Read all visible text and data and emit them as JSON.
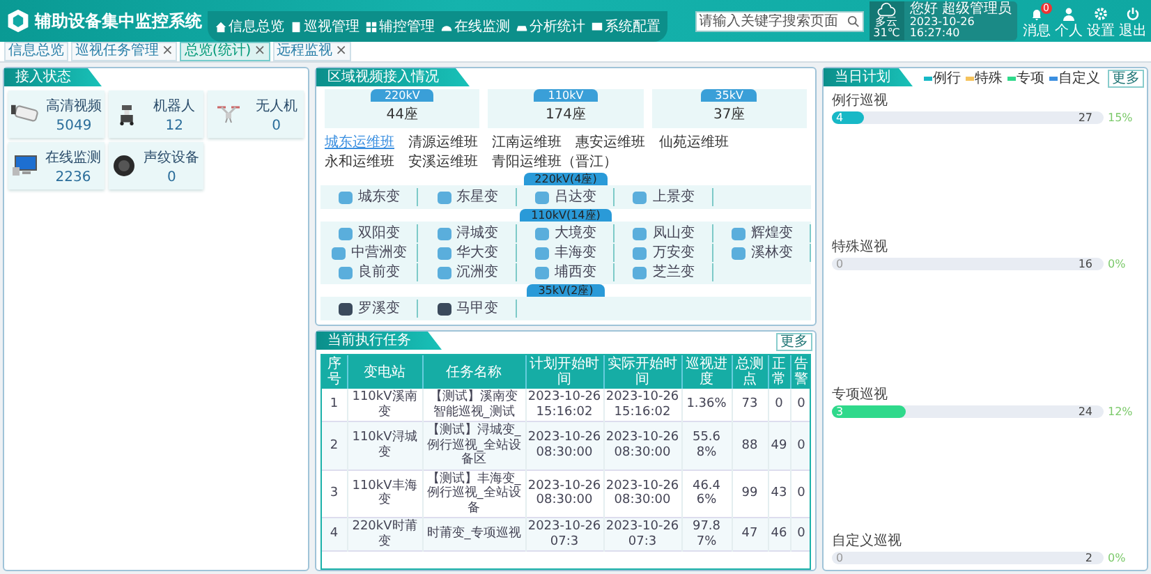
{
  "header": {
    "title": "辅助设备集中监控系统",
    "nav": [
      {
        "label": "信息总览",
        "kind": "home"
      },
      {
        "label": "巡视管理",
        "kind": "patrol"
      },
      {
        "label": "辅控管理",
        "kind": "control"
      },
      {
        "label": "在线监测",
        "kind": "monitor"
      },
      {
        "label": "分析统计",
        "kind": "chart"
      },
      {
        "label": "系统配置",
        "kind": "config"
      }
    ],
    "search": {
      "placeholder": "请输入关键字搜索页面"
    },
    "weather": {
      "condition": "多云",
      "temperature": "31℃"
    },
    "user": {
      "greeting": "您好 超级管理员",
      "date": "2023-10-26",
      "time": "16:27:40"
    },
    "actions": [
      {
        "label": "消息",
        "kind": "bell",
        "badge": "0"
      },
      {
        "label": "个人",
        "kind": "person"
      },
      {
        "label": "设置",
        "kind": "gear"
      },
      {
        "label": "退出",
        "kind": "power"
      }
    ]
  },
  "tabs": [
    {
      "label": "信息总览",
      "selected": false
    },
    {
      "label": "巡视任务管理",
      "close": "×",
      "selected": false
    },
    {
      "label": "总览(统计)",
      "close": "×",
      "selected": true
    },
    {
      "label": "远程监视",
      "close": "×",
      "selected": false
    }
  ],
  "access_status": {
    "title": "接入状态",
    "items": [
      {
        "kind": "camera",
        "label": "高清视频",
        "count": "5049"
      },
      {
        "kind": "robot",
        "label": "机器人",
        "count": "12"
      },
      {
        "kind": "drone",
        "label": "无人机",
        "count": "0"
      },
      {
        "kind": "monitor",
        "label": "在线监测",
        "count": "2236"
      },
      {
        "kind": "sound",
        "label": "声纹设备",
        "count": "0"
      }
    ]
  },
  "regional_video": {
    "title": "区域视频接入情况",
    "voltage_summary": [
      {
        "level": "220kV",
        "count": "44座"
      },
      {
        "level": "110kV",
        "count": "174座"
      },
      {
        "level": "35kV",
        "count": "37座"
      }
    ],
    "teams": [
      {
        "label": "城东运维班",
        "selected": true
      },
      {
        "label": "清源运维班",
        "selected": false
      },
      {
        "label": "江南运维班",
        "selected": false
      },
      {
        "label": "惠安运维班",
        "selected": false
      },
      {
        "label": "仙苑运维班",
        "selected": false
      },
      {
        "label": "永和运维班",
        "selected": false
      },
      {
        "label": "安溪运维班",
        "selected": false
      },
      {
        "label": "青阳运维班（晋江）",
        "selected": false
      }
    ],
    "groups": [
      {
        "label": "220kV(4座)",
        "stations": [
          {
            "name": "城东变",
            "online": true
          },
          {
            "name": "东星变",
            "online": true
          },
          {
            "name": "吕达变",
            "online": true
          },
          {
            "name": "上景变",
            "online": true
          }
        ]
      },
      {
        "label": "110kV(14座)",
        "stations": [
          {
            "name": "双阳变",
            "online": true
          },
          {
            "name": "浔城变",
            "online": true
          },
          {
            "name": "大境变",
            "online": true
          },
          {
            "name": "凤山变",
            "online": true
          },
          {
            "name": "辉煌变",
            "online": true
          },
          {
            "name": "中营洲变",
            "online": true
          },
          {
            "name": "华大变",
            "online": true
          },
          {
            "name": "丰海变",
            "online": true
          },
          {
            "name": "万安变",
            "online": true
          },
          {
            "name": "溪林变",
            "online": true
          },
          {
            "name": "良前变",
            "online": true
          },
          {
            "name": "沉洲变",
            "online": true
          },
          {
            "name": "埔西变",
            "online": true
          },
          {
            "name": "芝兰变",
            "online": true
          }
        ]
      },
      {
        "label": "35kV(2座)",
        "stations": [
          {
            "name": "罗溪变",
            "online": false
          },
          {
            "name": "马甲变",
            "online": false
          }
        ]
      }
    ]
  },
  "current_tasks": {
    "title": "当前执行任务",
    "more": "更多",
    "columns": [
      "序号",
      "变电站",
      "任务名称",
      "计划开始时间",
      "实际开始时间",
      "巡视进度",
      "总测点",
      "正常",
      "告警"
    ],
    "rows": [
      {
        "index": "1",
        "station": "110kV溪南变",
        "task": "【测试】溪南变智能巡视_测试",
        "planned_start": "2023-10-26 15:16:02",
        "actual_start": "2023-10-26 15:16:02",
        "progress": "1.36%",
        "points": "73",
        "normal": "0",
        "alarm": "0"
      },
      {
        "index": "2",
        "station": "110kV浔城变",
        "task": "【测试】浔城变_例行巡视_全站设备区",
        "planned_start": "2023-10-26 08:30:00",
        "actual_start": "2023-10-26 08:30:00",
        "progress": "55.68%",
        "points": "88",
        "normal": "49",
        "alarm": "0"
      },
      {
        "index": "3",
        "station": "110kV丰海变",
        "task": "【测试】丰海变_例行巡视_全站设备",
        "planned_start": "2023-10-26 08:30:00",
        "actual_start": "2023-10-26 08:30:00",
        "progress": "46.46%",
        "points": "99",
        "normal": "43",
        "alarm": "0"
      },
      {
        "index": "4",
        "station": "220kV时莆变",
        "task": "时莆变_专项巡视",
        "planned_start": "2023-10-26 07:3",
        "actual_start": "2023-10-26 07:3",
        "progress": "97.87%",
        "points": "47",
        "normal": "46",
        "alarm": "0"
      }
    ]
  },
  "daily_plan": {
    "title": "当日计划",
    "more": "更多",
    "legend": [
      {
        "label": "例行",
        "color": "#17b8c6"
      },
      {
        "label": "特殊",
        "color": "#f5c35c"
      },
      {
        "label": "专项",
        "color": "#2fd98b"
      },
      {
        "label": "自定义",
        "color": "#3b8fe0"
      }
    ],
    "plans": [
      {
        "label": "例行巡视",
        "done": "4",
        "total": "27",
        "percent": "15%",
        "level": 0.12
      },
      {
        "label": "特殊巡视",
        "done": "0",
        "total": "16",
        "percent": "0%",
        "level": 0
      },
      {
        "label": "专项巡视",
        "done": "3",
        "total": "24",
        "percent": "12%",
        "level": 0.27
      },
      {
        "label": "自定义巡视",
        "done": "0",
        "total": "2",
        "percent": "0%",
        "level": 0
      }
    ]
  }
}
